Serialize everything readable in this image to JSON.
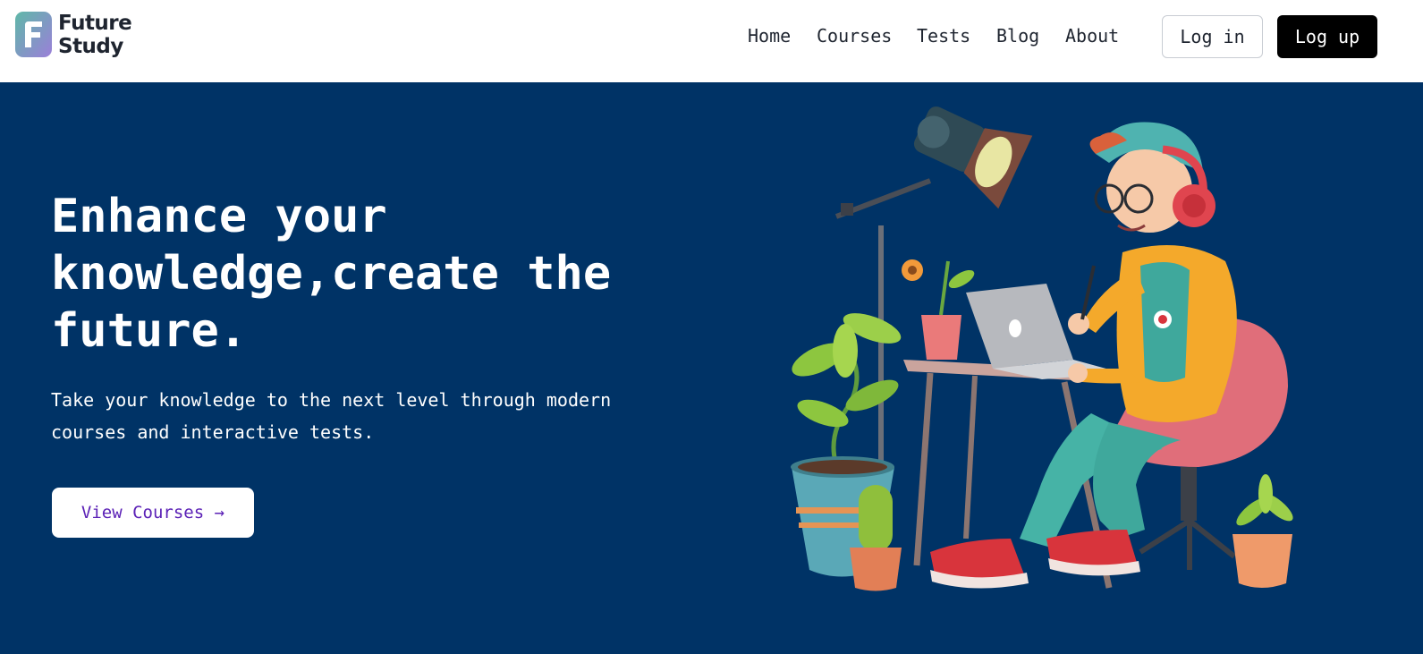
{
  "brand": {
    "line1": "Future",
    "line2": "Study"
  },
  "nav": {
    "items": [
      "Home",
      "Courses",
      "Tests",
      "Blog",
      "About"
    ]
  },
  "auth": {
    "login_label": "Log in",
    "logup_label": "Log up"
  },
  "hero": {
    "title_line1": "Enhance your",
    "title_line2": "knowledge,create the",
    "title_line3": "future.",
    "subtitle_line1": "Take your knowledge to the next level through modern",
    "subtitle_line2": "courses and interactive tests.",
    "cta_label": "View Courses →"
  },
  "colors": {
    "hero_bg": "#003366",
    "cta_text": "#5b21b6",
    "logup_bg": "#000000"
  }
}
